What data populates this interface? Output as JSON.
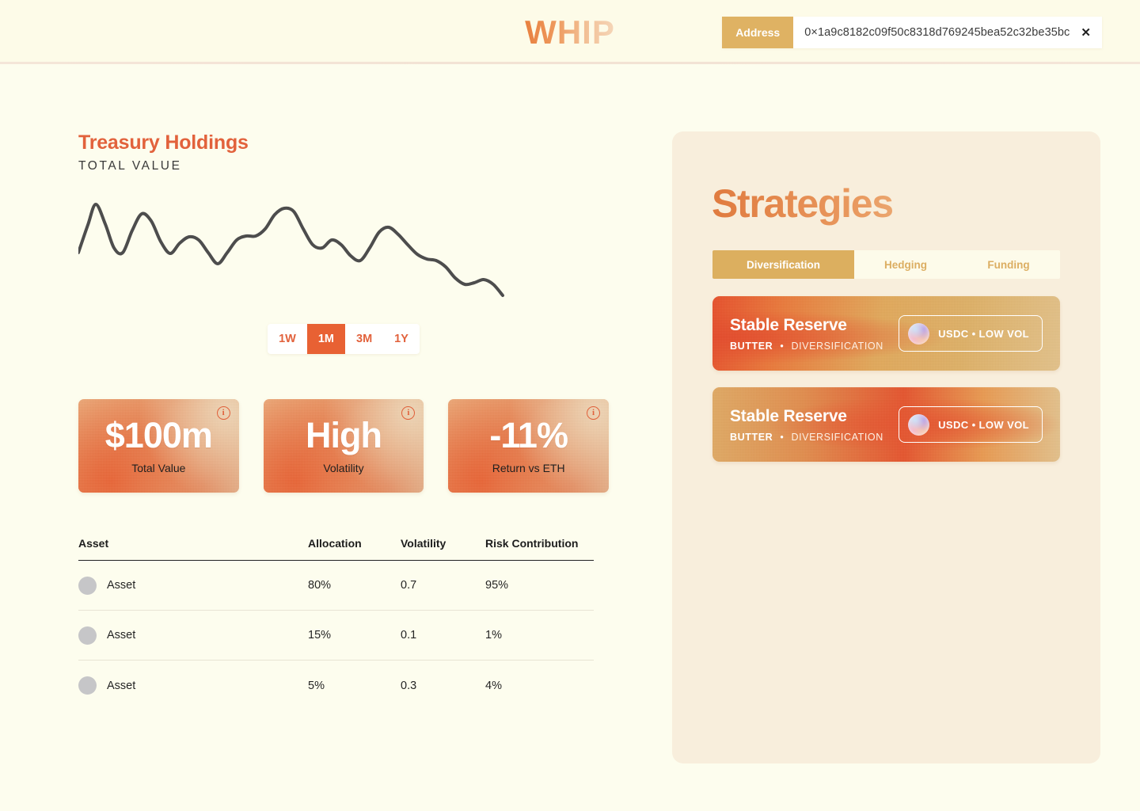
{
  "header": {
    "logo": "WHIP",
    "address_label": "Address",
    "address_value": "0×1a9c8182c09f50c8318d769245bea52c32be35bc",
    "close_glyph": "✕"
  },
  "treasury": {
    "title": "Treasury Holdings",
    "subtitle": "TOTAL VALUE",
    "ranges": [
      {
        "label": "1W",
        "active": false
      },
      {
        "label": "1M",
        "active": true
      },
      {
        "label": "3M",
        "active": false
      },
      {
        "label": "1Y",
        "active": false
      }
    ]
  },
  "stats": [
    {
      "value": "$100m",
      "label": "Total Value",
      "info": "i"
    },
    {
      "value": "High",
      "label": "Volatility",
      "info": "i"
    },
    {
      "value": "-11%",
      "label": "Return vs ETH",
      "info": "i"
    }
  ],
  "table": {
    "headers": {
      "asset": "Asset",
      "allocation": "Allocation",
      "volatility": "Volatility",
      "risk": "Risk Contribution"
    },
    "rows": [
      {
        "asset": "Asset",
        "allocation": "80%",
        "volatility": "0.7",
        "risk": "95%"
      },
      {
        "asset": "Asset",
        "allocation": "15%",
        "volatility": "0.1",
        "risk": "1%"
      },
      {
        "asset": "Asset",
        "allocation": "5%",
        "volatility": "0.3",
        "risk": "4%"
      }
    ]
  },
  "strategies": {
    "title": "Strategies",
    "tabs": [
      {
        "label": "Diversification",
        "active": true
      },
      {
        "label": "Hedging",
        "active": false
      },
      {
        "label": "Funding",
        "active": false
      }
    ],
    "cards": [
      {
        "name": "Stable Reserve",
        "issuer": "BUTTER",
        "separator": "•",
        "category": "DIVERSIFICATION",
        "pill": "USDC • LOW VOL"
      },
      {
        "name": "Stable Reserve",
        "issuer": "BUTTER",
        "separator": "•",
        "category": "DIVERSIFICATION",
        "pill": "USDC • LOW VOL"
      }
    ]
  },
  "colors": {
    "page_background": "#fdfdee",
    "header_background": "#fdfbe8",
    "accent_orange": "#e2623c",
    "accent_tan": "#dcaf5f",
    "panel_background": "#f8eedc",
    "chart_line": "#4d4d4d",
    "asset_dot": "#c6c6c8"
  },
  "chart_data": {
    "type": "line",
    "title": "Treasury Holdings",
    "subtitle": "TOTAL VALUE",
    "xlabel": "",
    "ylabel": "",
    "grid": false,
    "legend": null,
    "series": [
      {
        "name": "Total Value",
        "x": [
          0,
          3,
          7,
          11,
          15,
          19,
          23,
          27,
          31,
          35,
          39,
          43,
          47,
          51,
          55,
          59,
          63,
          67,
          71,
          75,
          79,
          83,
          87,
          91,
          95,
          100
        ],
        "values": [
          46,
          69,
          84,
          74,
          58,
          50,
          60,
          75,
          78,
          64,
          53,
          59,
          60,
          46,
          53,
          64,
          64,
          72,
          83,
          82,
          64,
          53,
          58,
          50,
          57,
          67,
          49,
          40,
          38,
          45,
          42,
          30,
          33,
          32,
          24
        ]
      }
    ],
    "path_points": [
      [
        0,
        78
      ],
      [
        12,
        43
      ],
      [
        22,
        17
      ],
      [
        34,
        42
      ],
      [
        45,
        72
      ],
      [
        56,
        78
      ],
      [
        68,
        50
      ],
      [
        80,
        29
      ],
      [
        92,
        38
      ],
      [
        104,
        64
      ],
      [
        116,
        79
      ],
      [
        128,
        66
      ],
      [
        140,
        58
      ],
      [
        152,
        62
      ],
      [
        164,
        78
      ],
      [
        176,
        92
      ],
      [
        188,
        78
      ],
      [
        200,
        62
      ],
      [
        212,
        57
      ],
      [
        224,
        57
      ],
      [
        236,
        48
      ],
      [
        248,
        30
      ],
      [
        260,
        22
      ],
      [
        272,
        26
      ],
      [
        284,
        48
      ],
      [
        296,
        68
      ],
      [
        308,
        72
      ],
      [
        320,
        62
      ],
      [
        332,
        68
      ],
      [
        344,
        82
      ],
      [
        356,
        88
      ],
      [
        368,
        72
      ],
      [
        380,
        52
      ],
      [
        392,
        46
      ],
      [
        404,
        55
      ],
      [
        416,
        68
      ],
      [
        428,
        80
      ],
      [
        440,
        86
      ],
      [
        452,
        88
      ],
      [
        464,
        96
      ],
      [
        476,
        110
      ],
      [
        488,
        118
      ],
      [
        500,
        116
      ],
      [
        512,
        112
      ],
      [
        524,
        118
      ],
      [
        536,
        132
      ]
    ],
    "ylim": [
      0,
      100
    ],
    "xlim": [
      0,
      100
    ],
    "line_color": "#4d4d4d",
    "line_width": 4
  }
}
